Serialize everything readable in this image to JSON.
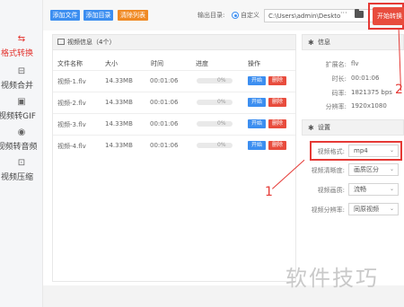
{
  "sidebar": {
    "items": [
      {
        "label": "格式转换",
        "icon": "convert-icon",
        "active": true
      },
      {
        "label": "视频合并",
        "icon": "merge-icon",
        "active": false
      },
      {
        "label": "视频转GIF",
        "icon": "gif-icon",
        "active": false
      },
      {
        "label": "视频转音频",
        "icon": "audio-icon",
        "active": false
      },
      {
        "label": "视频压缩",
        "icon": "compress-icon",
        "active": false
      }
    ]
  },
  "toolbar": {
    "add_file": "添加文件",
    "add_folder": "添加目录",
    "clear_list": "清除列表",
    "output_label": "输出目录:",
    "custom_label": "自定义",
    "path_value": "C:\\Users\\admin\\Deskto",
    "more_label": "···",
    "start_convert": "开始转换"
  },
  "file_panel": {
    "title": "视频信息（4个）",
    "columns": [
      "文件名称",
      "大小",
      "时间",
      "进度",
      "操作"
    ],
    "rows": [
      {
        "name": "视频-1.flv",
        "size": "14.33MB",
        "time": "00:01:06",
        "progress": "0%"
      },
      {
        "name": "视频-2.flv",
        "size": "14.33MB",
        "time": "00:01:06",
        "progress": "0%"
      },
      {
        "name": "视频-3.flv",
        "size": "14.33MB",
        "time": "00:01:06",
        "progress": "0%"
      },
      {
        "name": "视频-4.flv",
        "size": "14.33MB",
        "time": "00:01:06",
        "progress": "0%"
      }
    ],
    "start_label": "开始",
    "delete_label": "删除"
  },
  "info_panel": {
    "title": "信息",
    "ext_label": "扩展名:",
    "ext_value": "flv",
    "duration_label": "时长:",
    "duration_value": "00:01:06",
    "bitrate_label": "码率:",
    "bitrate_value": "1821375 bps",
    "resolution_label": "分辨率:",
    "resolution_value": "1920x1080"
  },
  "settings_panel": {
    "title": "设置",
    "format_label": "视频格式:",
    "format_value": "mp4",
    "clarity_label": "视频清晰度:",
    "clarity_value": "画质区分",
    "quality_label": "视频画质:",
    "quality_value": "流畅",
    "resolution_label": "视频分辨率:",
    "resolution_value": "同原视频"
  },
  "annotations": {
    "step1": "1",
    "step2": "2"
  },
  "watermark": "软件技巧",
  "colors": {
    "accent_red": "#e84c3d",
    "accent_blue": "#3c8ef0",
    "accent_orange": "#f08a24"
  }
}
